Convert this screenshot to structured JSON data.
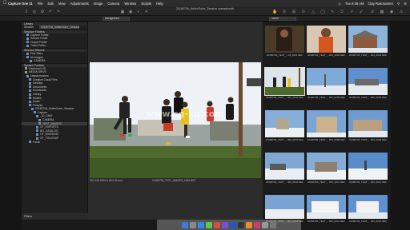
{
  "menubar": {
    "app_name": "Capture One 11",
    "items": [
      "File",
      "Edit",
      "View",
      "Adjustments",
      "Image",
      "Camera",
      "Window",
      "Scripts",
      "Help"
    ],
    "clock": "Tue 8:36 AM",
    "user": "Clay Rasmussen"
  },
  "toolbar": {
    "window_title": "20180706_KellenSoire_Session.cosessiondb",
    "background_select": "Background",
    "sort_select": "Name"
  },
  "sidebar": {
    "library_header": "Library",
    "session_label": "Session",
    "session_name": "20180706_KellenSoire_Session",
    "session_folders_header": "Session Folders",
    "session_folders": [
      "Capture Folder",
      "Selects Folder",
      "Output Folder",
      "Trash Folder"
    ],
    "session_albums_header": "Session Albums",
    "session_albums": [
      "Five Stars",
      "All Images"
    ],
    "session_favorites": [
      "CAMERA"
    ],
    "system_folders_header": "System Folders",
    "system_folders": [
      "Macintosh HD",
      "MEDIA DRIVE",
      "clayrasmussen",
      "Creative Cloud Files",
      "Desktop",
      "Documents",
      "Downloads",
      "Library",
      "Movies",
      "Music",
      "Pictures",
      "20180706_KellenSoire_Session",
      "Capture",
      "_ID_C500",
      "CAMERA",
      "TEST_IMAGES",
      "OT_EXPORTS",
      "BG_CATALOG",
      "OT_WORKING",
      "OT_TOUCHUP",
      "Public"
    ],
    "filters_label": "Filters"
  },
  "viewer": {
    "caption_left": "ISO 125  1/500 s  f/5.6  50 mm",
    "caption_filename": "20180706_TEST_IMAGES_0015.NEF"
  },
  "browser": {
    "thumbnails": [
      "20180706_TEST_...03_0001.NEF",
      "20180706_TEST_...003_0002.NEF",
      "20180706_TEST_...003_0003.NEF",
      "20180706_TEST_...003_0004.NEF",
      "20180706_TEST_...003_0005.NEF",
      "20180706_TEST_...003_0006.NEF",
      "20180706_TEST_...003_0007.NEF",
      "20180706_TEST_...003_0008.NEF",
      "20180706_TEST_...003_0009.NEF",
      "20180706_TEST_...003_0010.NEF",
      "20180706_TEST_...003_0011.NEF",
      "20180706_TEST_...003_0012.NEF",
      "20180706_TEST_...003_0013.NEF",
      "20180706_TEST_...003_0014.NEF",
      "20180706_TEST_...003_0015.NEF"
    ]
  },
  "watermark": "www.cg-ku.com",
  "colors": {
    "app_bg": "#1a1a1a",
    "panel_bg": "#1f1f1f",
    "folder_icon": "#6f8fb8",
    "watermark": "#ffffff"
  }
}
